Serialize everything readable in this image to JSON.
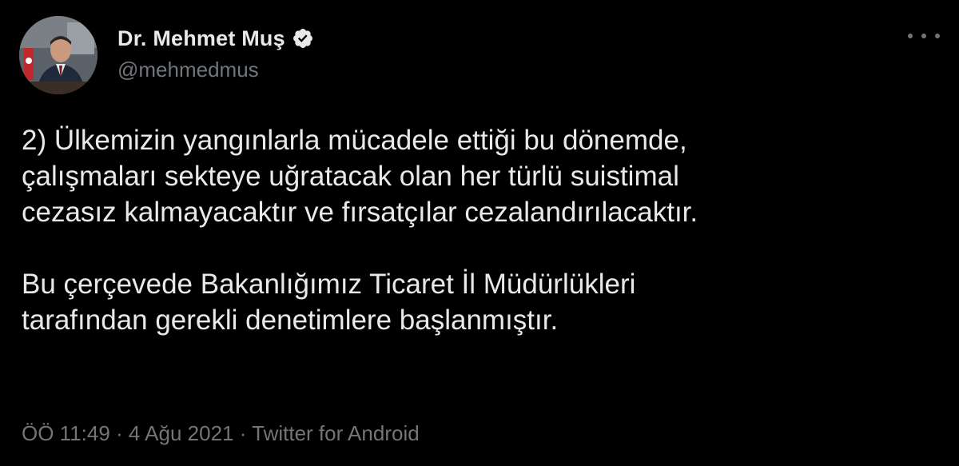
{
  "author": {
    "display_name": "Dr. Mehmet Muş",
    "handle": "@mehmedmus",
    "verified": true
  },
  "tweet": {
    "paragraph_1": [
      "2) Ülkemizin yangınlarla mücadele ettiği bu dönemde,",
      "çalışmaları sekteye uğratacak olan her türlü suistimal",
      "cezasız kalmayacaktır ve fırsatçılar cezalandırılacaktır."
    ],
    "paragraph_2": [
      "Bu çerçevede Bakanlığımız Ticaret İl Müdürlükleri",
      "tarafından gerekli denetimlere başlanmıştır."
    ]
  },
  "meta": {
    "time": "ÖÖ 11:49",
    "separator": " · ",
    "date": "4 Ağu 2021",
    "source": "Twitter for Android"
  },
  "icons": {
    "verified": "verified-badge-icon",
    "more": "more-horizontal-icon"
  },
  "colors": {
    "background": "#000000",
    "primary_text": "#e7e9ea",
    "secondary_text": "#71767b"
  }
}
